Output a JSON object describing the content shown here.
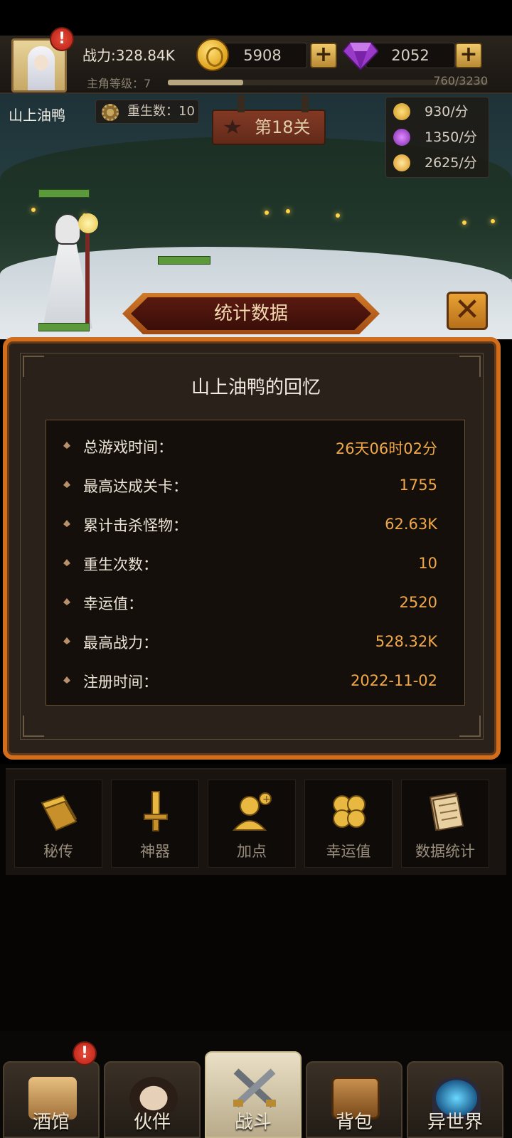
{
  "header": {
    "power": "战力:328.84K",
    "gold": "5908",
    "gems": "2052",
    "level_label": "主角等级：7",
    "level_progress": "760/3230",
    "level_fraction": 0.235,
    "alert": "!"
  },
  "scene": {
    "player_name": "山上油鸭",
    "rebirth": "重生数：10",
    "stage": "第18关",
    "rates": [
      "930/分",
      "1350/分",
      "2625/分"
    ]
  },
  "dialog": {
    "title": "统计数据",
    "memory_title": "山上油鸭的回忆",
    "stats": [
      {
        "label": "总游戏时间：",
        "value": "26天06时02分"
      },
      {
        "label": "最高达成关卡：",
        "value": "1755"
      },
      {
        "label": "累计击杀怪物：",
        "value": "62.63K"
      },
      {
        "label": "重生次数：",
        "value": "10"
      },
      {
        "label": "幸运值：",
        "value": "2520"
      },
      {
        "label": "最高战力：",
        "value": "528.32K"
      },
      {
        "label": "注册时间：",
        "value": "2022-11-02"
      }
    ]
  },
  "skills": [
    {
      "label": "秘传",
      "icon": "book-icon"
    },
    {
      "label": "神器",
      "icon": "sword-icon"
    },
    {
      "label": "加点",
      "icon": "add-point-icon"
    },
    {
      "label": "幸运值",
      "icon": "clover-icon"
    },
    {
      "label": "数据统计",
      "icon": "document-icon"
    }
  ],
  "nav": [
    {
      "label": "酒馆",
      "icon": "beer-mug-icon",
      "alert": "!"
    },
    {
      "label": "伙伴",
      "icon": "companion-icon"
    },
    {
      "label": "战斗",
      "icon": "crossed-swords-icon",
      "active": true
    },
    {
      "label": "背包",
      "icon": "chest-icon"
    },
    {
      "label": "异世界",
      "icon": "portal-icon"
    }
  ],
  "colors": {
    "accent_orange": "#d06e1e",
    "stat_value": "#f0a848",
    "panel_bg": "#2a211a"
  }
}
